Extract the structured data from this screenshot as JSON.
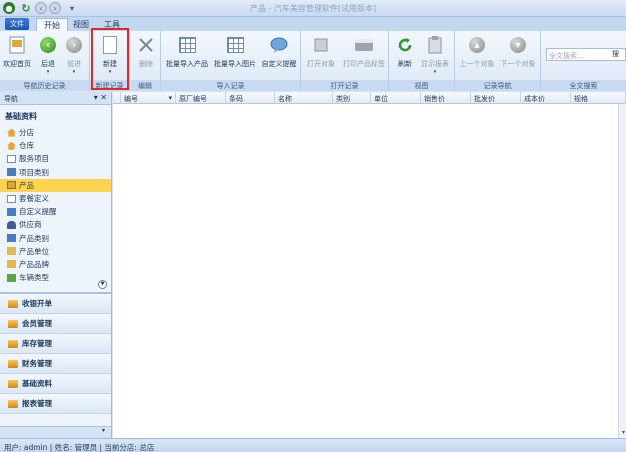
{
  "window": {
    "title": "产品 - 汽车美容管理软件[试用版本]"
  },
  "app_menu_label": "文件",
  "tabs": [
    "开始",
    "视图",
    "工具"
  ],
  "ribbon": {
    "buttons": {
      "welcome": "欢迎首页",
      "back": "后退",
      "forward": "前进",
      "new": "新建",
      "delete": "删除",
      "import_products": "批量导入产品",
      "import_images": "批量导入图片",
      "custom_reminder": "自定义提醒",
      "open_object": "打开对象",
      "print_label": "打印产品标签",
      "refresh": "刷新",
      "show_report": "显示报表",
      "prev_record": "上一个对象",
      "next_record": "下一个对象"
    },
    "groups": {
      "nav_history": "导航历史记录",
      "new_record": "新建记录",
      "edit": "编辑",
      "import_records": "导入记录",
      "open_record": "打开记录",
      "view": "视图",
      "record_nav": "记录导航",
      "fulltext_search": "全文搜索"
    },
    "search": {
      "placeholder": "全文搜索...",
      "go": "搜"
    }
  },
  "nav": {
    "header": "导航",
    "header_buttons": "▾ ✕",
    "section_title": "基础资料",
    "items": [
      {
        "label": "分店",
        "icon": "house-icon"
      },
      {
        "label": "仓库",
        "icon": "house-icon"
      },
      {
        "label": "服务项目",
        "icon": "list-icon"
      },
      {
        "label": "项目类别",
        "icon": "category-icon"
      },
      {
        "label": "产品",
        "icon": "product-icon"
      },
      {
        "label": "套餐定义",
        "icon": "package-icon"
      },
      {
        "label": "自定义提醒",
        "icon": "reminder-icon"
      },
      {
        "label": "供应商",
        "icon": "supplier-icon"
      },
      {
        "label": "产品类别",
        "icon": "category-icon"
      },
      {
        "label": "产品单位",
        "icon": "unit-icon"
      },
      {
        "label": "产品品牌",
        "icon": "brand-icon"
      },
      {
        "label": "车辆类型",
        "icon": "car-icon"
      }
    ],
    "modules": [
      "收银开单",
      "会员管理",
      "库存管理",
      "财务管理",
      "基础资料",
      "报表管理"
    ]
  },
  "grid": {
    "columns": [
      "编号",
      "原厂编号",
      "条码",
      "名称",
      "类别",
      "单位",
      "销售价",
      "批发价",
      "成本价",
      "规格"
    ]
  },
  "status": {
    "text": "用户: admin  |  姓名: 管理员  |  当前分店: 总店"
  },
  "colors": {
    "accent": "#1b55b0",
    "highlight_border": "#e0282c",
    "selection": "#ffd34e"
  }
}
